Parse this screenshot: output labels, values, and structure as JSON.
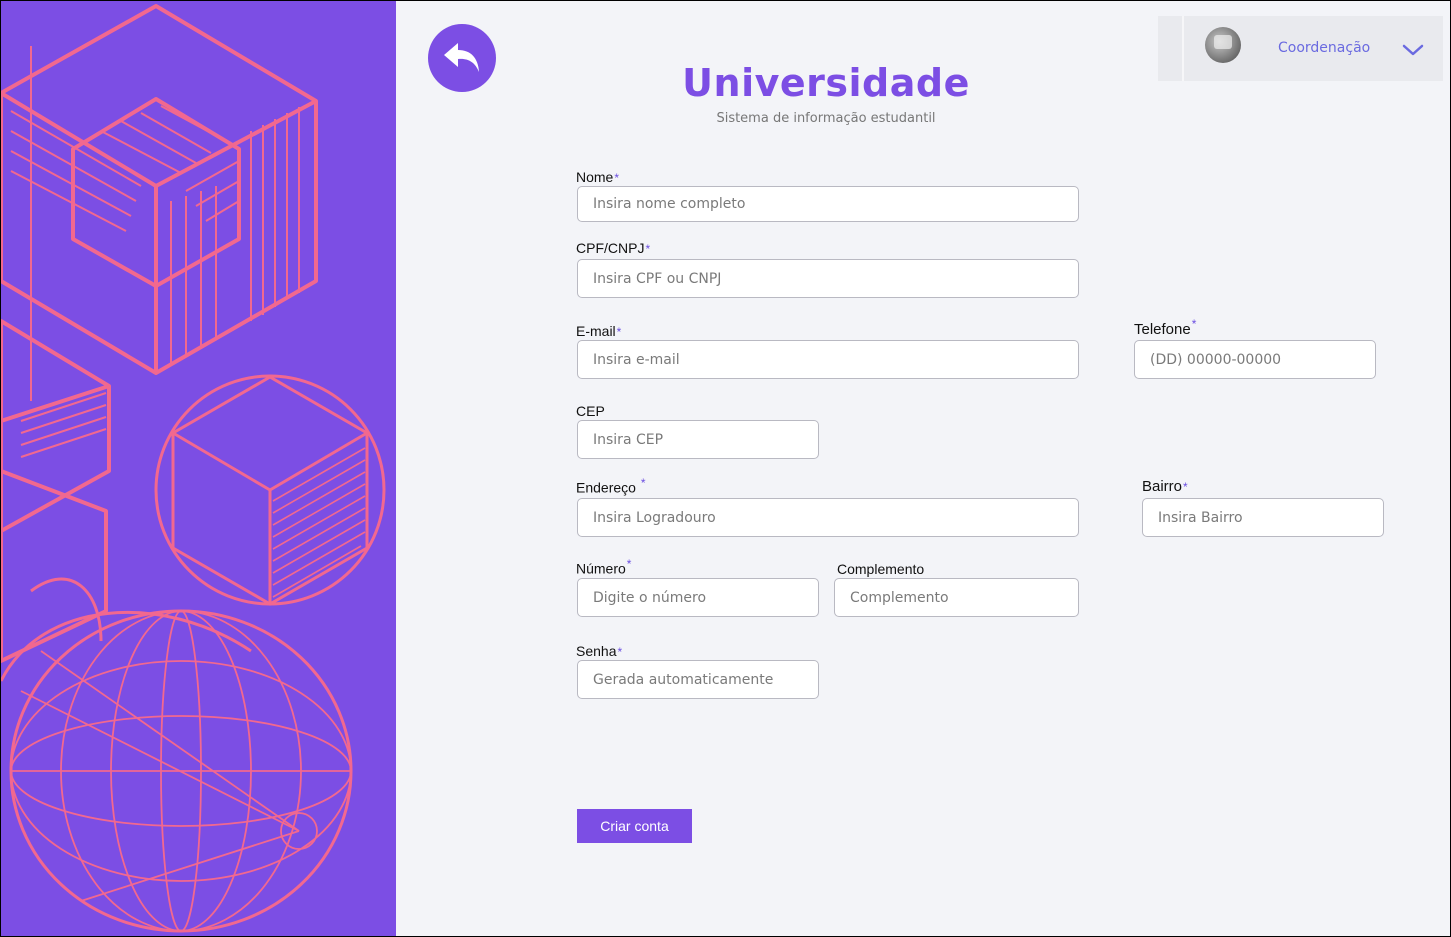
{
  "header": {
    "title": "Universidade",
    "subtitle": "Sistema de informação estudantil"
  },
  "user": {
    "name": "Coordenação"
  },
  "colors": {
    "accent": "#7c4ee4",
    "decor": "#f2688f",
    "background": "#f3f4f8"
  },
  "icons": {
    "back": "reply-arrow-icon",
    "chevron": "chevron-down-icon"
  },
  "form": {
    "nome": {
      "label": "Nome",
      "required": "*",
      "placeholder": "Insira nome completo"
    },
    "cpf": {
      "label": "CPF/CNPJ",
      "required": "*",
      "placeholder": "Insira CPF ou CNPJ"
    },
    "email": {
      "label": "E-mail",
      "required": "*",
      "placeholder": "Insira e-mail"
    },
    "telefone": {
      "label": "Telefone",
      "required": "*",
      "placeholder": "(DD) 00000-00000"
    },
    "cep": {
      "label": "CEP",
      "placeholder": "Insira CEP"
    },
    "endereco": {
      "label": "Endereço",
      "required": "*",
      "placeholder": "Insira Logradouro"
    },
    "bairro": {
      "label": "Bairro",
      "required": "*",
      "placeholder": "Insira Bairro"
    },
    "numero": {
      "label": "Número",
      "required": "*",
      "placeholder": "Digite o número"
    },
    "complemento": {
      "label": "Complemento",
      "placeholder": "Complemento"
    },
    "senha": {
      "label": "Senha",
      "required": "*",
      "placeholder": "Gerada automaticamente"
    },
    "submit_label": "Criar conta"
  }
}
